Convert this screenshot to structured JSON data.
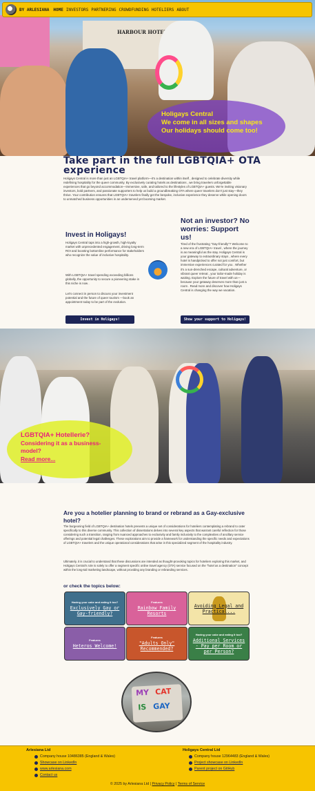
{
  "nav": {
    "brand": "BY ARLESIANA",
    "items": [
      "HOME",
      "INVESTORS",
      "PARTNERING",
      "CROWDFUNDING",
      "HOTELIERS",
      "ABOUT"
    ]
  },
  "hero": {
    "line1": "Holigays Central",
    "line2": "We come in all sizes and shapes",
    "line3": "Our holidays should come too!",
    "sign": "HARBOUR HOTEL"
  },
  "main_title": "Take part in the full LGBTQIA+ OTA experience",
  "intro": "Holigays Central is more than just an LGBTQIA+ travel platform—it's a destination within itself , designed to celebrate diversity while redefining hospitality for the queer community. By exclusively curating hotels as destinations , we bring travelers unforgettable experiences that go beyond accommodation—immersive, safe, and tailored to the lifestyles of LGBTQIA+ guests. We're inviting visionary investors, bold partners, and passionate supporters to help us build a groundbreaking OTA where queer travelers don't just stay—they thrive. Your contribution ensures that LGBTQIA+ travelers finally get the bespoke, inclusive experience they deserve while opening doors to unmatched business opportunities in an underserved yet booming market.",
  "invest": {
    "heading": "Invest in Holigays!",
    "p1": "Holigays Central taps into a high-growth, high-loyalty market with unprecedented engagement, driving long-term ROI and boosting bottomline performance for stakeholders who recognize the value of inclusive hospitality.",
    "p2": "With LGBTQIA+ travel spending exceeding billions globally, the opportunity to secure a pioneering stake in this niche is now .",
    "p3": "Let's connect in person to discuss your investment potential and the future of queer tourism —book an appointment today to be part of the evolution.",
    "button": "Invest in Holigays!"
  },
  "support": {
    "heading": "Not an investor? No worries: Support us!",
    "p1": "Tired of the frustrating \"Gay-friendly\"? Welcome to a new era of LGBTQIA+ travel , where the journey is as meaningful as the stay. Holigays Central is your gateway to extraordinary stays , where every hotel is handpicked to offer not just comfort, but immersive experiences curated for you . Whether it's a sun-drenched escape, cultural adventure, or vibrant queer retreat , your tailor-made holiday is waiting. Explore the future of travel with us—because your getaway deserves more than just a room . Read more and discover how Holigays Central is changing the way we vacation.",
    "button": "Show your support to Holigays!"
  },
  "hotelier_banner": {
    "title": "LGBTQIA+ Hotellerie?",
    "subtitle": "Considering it as a business-model?",
    "link": "Read more..."
  },
  "hotelier": {
    "heading": "Are you a hotelier planning to brand or rebrand as a Gay-exclusive hotel?",
    "p1": "The burgeoning field of LGBTQIA+ destination hotels presents a unique set of considerations for hoteliers contemplating a rebrand to cater specifically to this diverse community. This collection of dissertations delves into several key aspects that warrant careful reflection for those considering such a transition, ranging from nuanced approaches to exclusivity and family inclusivity to the complexities of ancillary service offerings and potential legal challenges. These explorations aim to provide a framework for understanding the specific needs and expectations of LGBTQIA+ travelers and the unique operational considerations that arise in this specialized segment of the hospitality industry.",
    "p2": "Ultimately, it is crucial to understand that these discussions are intended as thought-provoking topics for hoteliers exploring this market, and Holigays Central's role is solely to offer a segment specific online travel agency (OTA) service focused on the \"hotel as a destination\" concept within the long-tail marketing landscape, without providing any branding or rebranding services.",
    "topics_label": "or check the topics below:"
  },
  "cards": [
    {
      "label": "Having your cake and eating it too?",
      "title": "Exclusively Gay or Gay-friendly?",
      "bg": "#3f6f8c",
      "dark": false
    },
    {
      "label": "Features",
      "title": "Rainbow Family Resorts",
      "bg": "#d9629a",
      "dark": false
    },
    {
      "label": "",
      "title": "Avoiding Legal and Practical...",
      "bg": "#f3e4a8",
      "dark": true
    },
    {
      "label": "Features",
      "title": "Heteros Welcome!",
      "bg": "#8a5ea8",
      "dark": false
    },
    {
      "label": "Features",
      "title": "\"Adults Only\" Recommended?",
      "bg": "#c8562c",
      "dark": false
    },
    {
      "label": "Having your cake and eating it too?",
      "title": "Additional Services - Pay per Room or per Person?",
      "bg": "#3a7f47",
      "dark": false
    }
  ],
  "circle_sign": [
    "MY",
    "CAT",
    "IS",
    "GAY"
  ],
  "footer": {
    "left": {
      "heading": "Arlesiana Ltd",
      "items": [
        {
          "text": "Company house 10486385 (England & Wales)",
          "link": false
        },
        {
          "text": "Showcase on LinkedIn",
          "link": true
        },
        {
          "text": "www.arlesiana.com",
          "link": true
        },
        {
          "text": " Contact us",
          "link": true
        }
      ]
    },
    "right": {
      "heading": "Holigays Central Ltd",
      "items": [
        {
          "text": "Company house 12964483 (England & Wales)",
          "link": false
        },
        {
          "text": "Project showcase on LinkedIn",
          "link": true
        },
        {
          "text": "Parent project on GitHub",
          "link": true
        }
      ]
    },
    "copyright": "© 2025 by Arlesiana Ltd |",
    "privacy": "Privacy Policy",
    "sep": "|",
    "terms": "Terms of Service"
  }
}
